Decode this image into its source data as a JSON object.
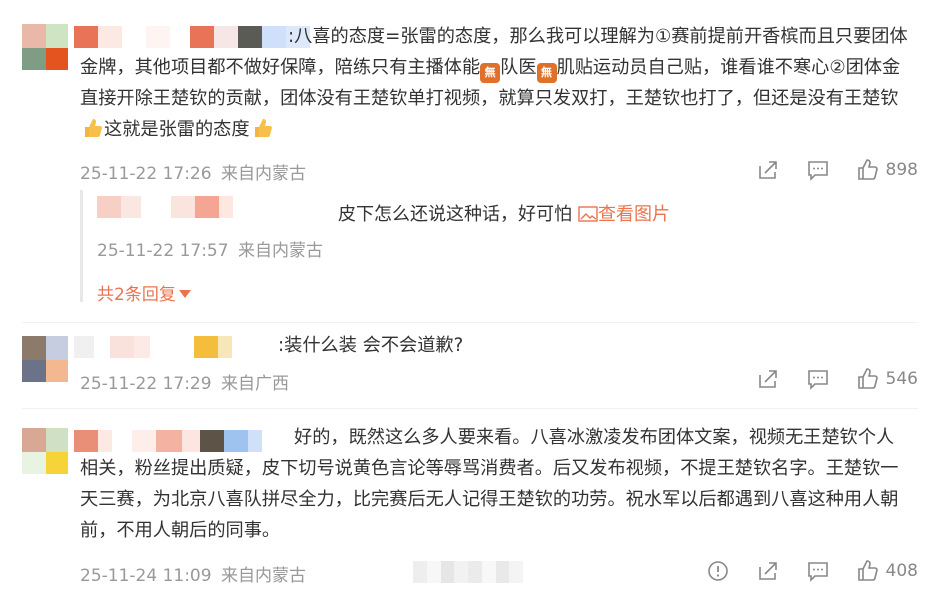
{
  "comments": [
    {
      "nick_suffix": ":",
      "text_1": "八喜的态度=张雷的态度，那么我可以理解为①赛前提前开香槟而且只要团体金牌，其他项目都不做好保障，陪练只有主播体能",
      "emoji_label": "無",
      "text_2": "队医",
      "text_3": "肌贴运动员自己贴，谁看谁不寒心②团体金直接开除王楚钦的贡献，团体没有王楚钦单打视频，就算只发双打，王楚钦也打了，但还是没有王楚钦",
      "text_4": "这就是张雷的态度",
      "time": "25-11-22 17:26",
      "source": "来自内蒙古",
      "likes": "898",
      "reply": {
        "text": "皮下怎么还说这种话，好可怕",
        "view_image": "查看图片",
        "time": "25-11-22 17:57",
        "source": "来自内蒙古",
        "more": "共2条回复"
      }
    },
    {
      "nick_suffix": ":",
      "text": "装什么装 会不会道歉?",
      "time": "25-11-22 17:29",
      "source": "来自广西",
      "likes": "546"
    },
    {
      "text": "好的，既然这么多人要来看。八喜冰激凌发布团体文案，视频无王楚钦个人相关，粉丝提出质疑，皮下切号说黄色言论等辱骂消费者。后又发布视频，不提王楚钦名字。王楚钦一天三赛，为北京八喜队拼尽全力，比完赛后无人记得王楚钦的功劳。祝水军以后都遇到八喜这种用人朝前，不用人朝后的同事。",
      "time": "25-11-24 11:09",
      "source": "来自内蒙古",
      "likes": "408"
    }
  ],
  "icons": {
    "share": "share-icon",
    "comment": "comment-icon",
    "like": "thumbs-up-icon",
    "report": "report-icon",
    "image": "image-icon",
    "caret": "caret-down-icon"
  },
  "colors": {
    "accent": "#eb7350",
    "meta": "#999999",
    "text": "#333333"
  }
}
